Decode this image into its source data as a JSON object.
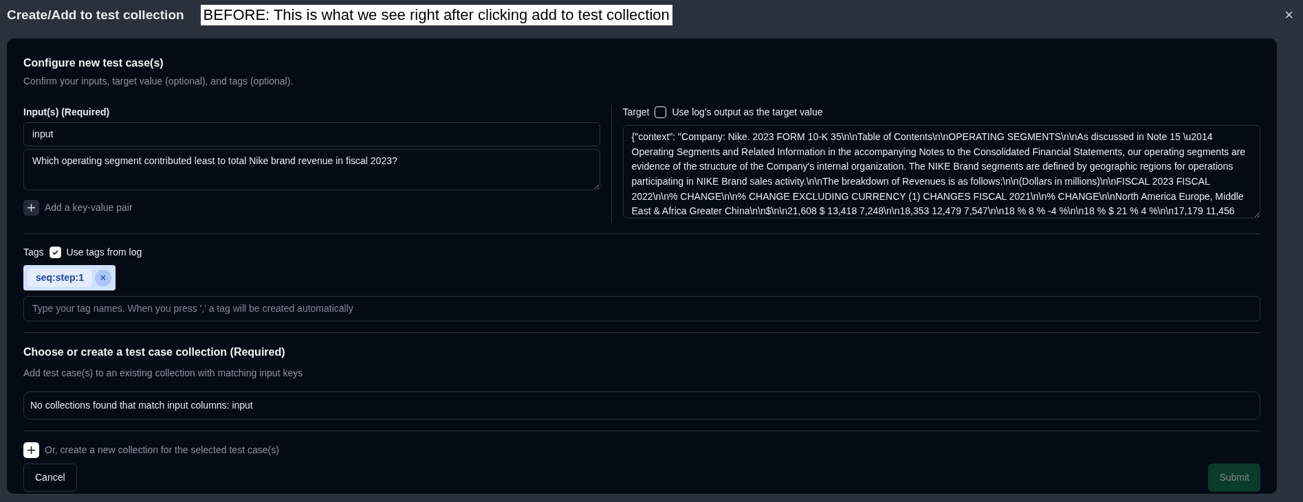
{
  "window": {
    "title": "Create/Add to test collection",
    "annotation": "BEFORE: This is what we see right after clicking add to test collection",
    "close": "×"
  },
  "configure": {
    "heading": "Configure new test case(s)",
    "subheading": "Confirm your inputs, target value (optional), and tags (optional)."
  },
  "inputs": {
    "label": "Input(s) (Required)",
    "key": "input",
    "value": "Which operating segment contributed least to total Nike brand revenue in fiscal 2023?",
    "add_pair": "Add a key-value pair"
  },
  "target": {
    "label": "Target",
    "checkbox_label": "Use log's output as the target value",
    "checked": false,
    "value": "{\"context\": \"Company: Nike. 2023 FORM 10-K 35\\n\\nTable of Contents\\n\\nOPERATING SEGMENTS\\n\\nAs discussed in Note 15 \\u2014 Operating Segments and Related Information in the accompanying Notes to the Consolidated Financial Statements, our operating segments are evidence of the structure of the Company's internal organization. The NIKE Brand segments are defined by geographic regions for operations participating in NIKE Brand sales activity.\\n\\nThe breakdown of Revenues is as follows:\\n\\n(Dollars in millions)\\n\\nFISCAL 2023 FISCAL 2022\\n\\n% CHANGE\\n\\n% CHANGE EXCLUDING CURRENCY (1) CHANGES FISCAL 2021\\n\\n% CHANGE\\n\\nNorth America Europe, Middle East & Africa Greater China\\n\\n$\\n\\n21,608 $ 13,418 7,248\\n\\n18,353 12,479 7,547\\n\\n18 % 8 % -4 %\\n\\n18 % $ 21 % 4 %\\n\\n17,179 11,456"
  },
  "tags": {
    "label": "Tags",
    "checkbox_label": "Use tags from log",
    "checked": true,
    "items": [
      {
        "label": "seq:step:1",
        "remove": "×"
      }
    ],
    "placeholder": "Type your tag names. When you press ',' a tag will be created automatically"
  },
  "collection": {
    "heading": "Choose or create a test case collection (Required)",
    "subheading": "Add test case(s) to an existing collection with matching input keys",
    "select_value": "No collections found that match input columns: input",
    "create_label": "Or, create a new collection for the selected test case(s)"
  },
  "buttons": [
    {
      "label": "Cancel",
      "kind": "secondary",
      "disabled": false
    },
    {
      "label": "Submit",
      "kind": "primary",
      "disabled": true
    }
  ]
}
